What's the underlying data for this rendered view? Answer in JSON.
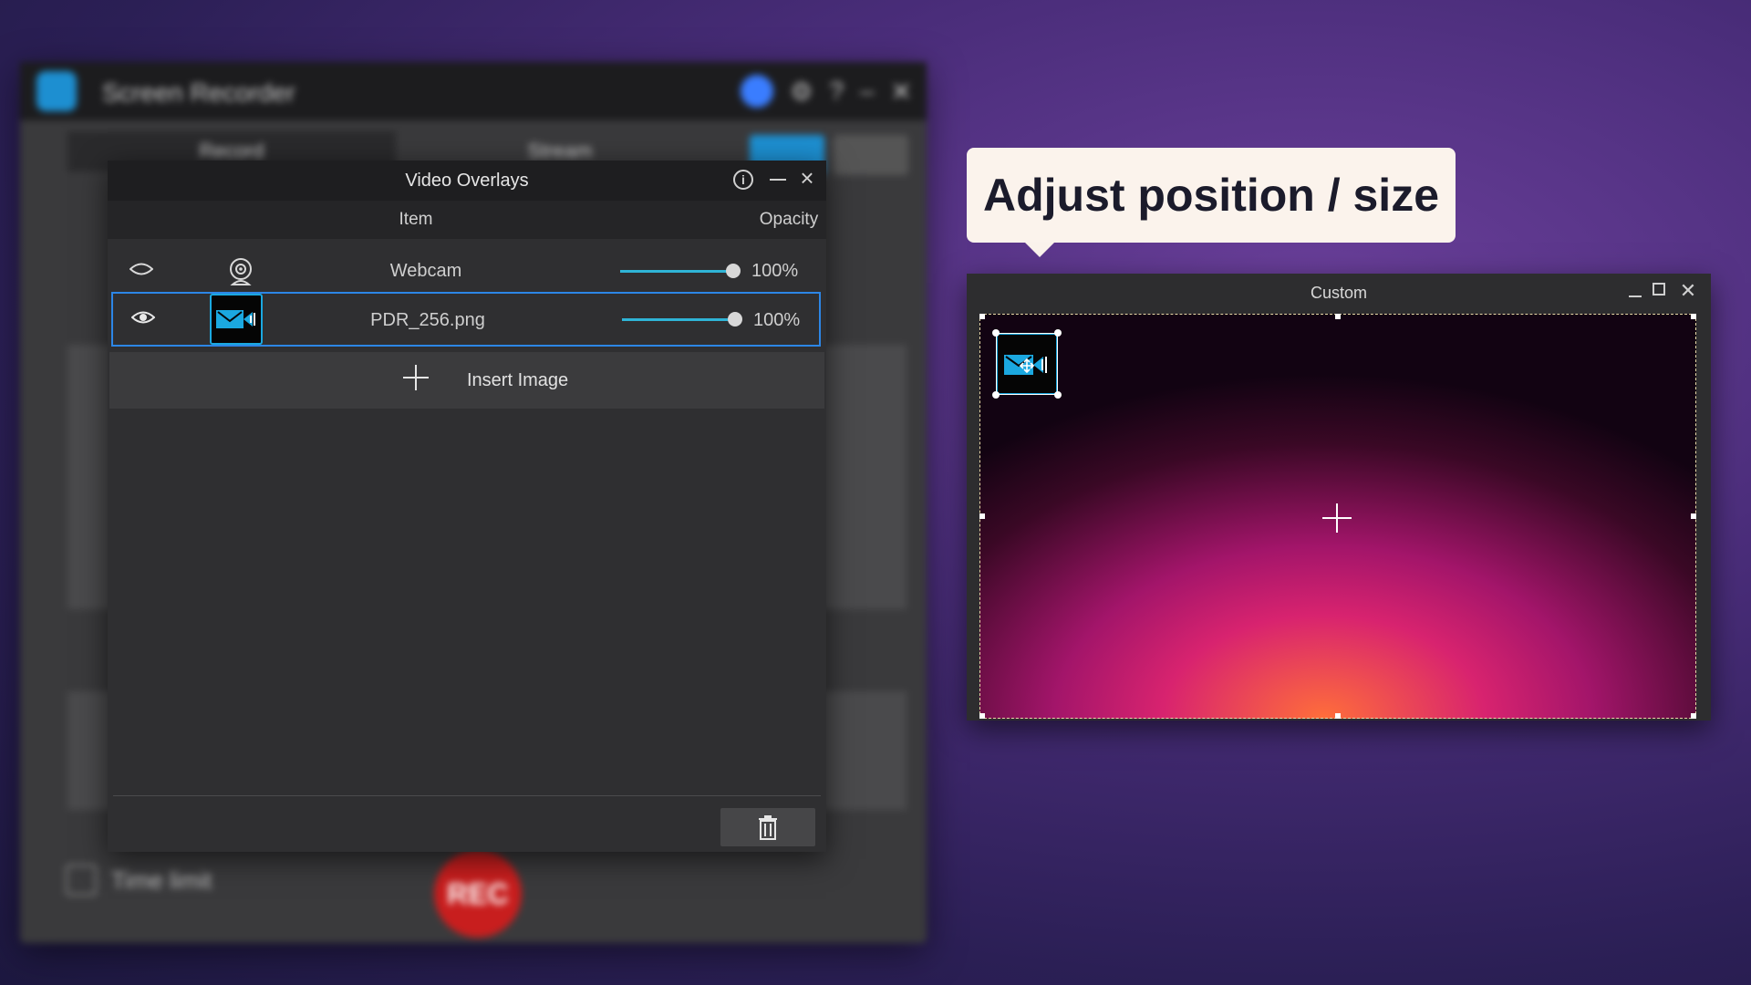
{
  "background_app": {
    "title": "Screen Recorder",
    "tabs": [
      "Record",
      "Stream"
    ],
    "time_limit_label": "Time limit",
    "rec_label": "REC"
  },
  "overlays_dialog": {
    "title": "Video Overlays",
    "columns": {
      "item": "Item",
      "opacity": "Opacity"
    },
    "rows": [
      {
        "name": "Webcam",
        "opacity": "100%",
        "opacity_value": 1.0,
        "visible": true,
        "icon": "webcam-icon"
      },
      {
        "name": "PDR_256.png",
        "opacity": "100%",
        "opacity_value": 1.0,
        "visible": true,
        "icon": "video-app-icon",
        "selected": true
      }
    ],
    "insert_label": "Insert Image",
    "icons": {
      "info": "info-icon",
      "delete": "trash-icon"
    }
  },
  "callout": {
    "text": "Adjust position / size"
  },
  "custom_window": {
    "title": "Custom"
  },
  "colors": {
    "accent": "#2fb4d6",
    "selection": "#2c86e6",
    "callout_bg": "#fbf3ec",
    "rec_red": "#c81e1e"
  }
}
